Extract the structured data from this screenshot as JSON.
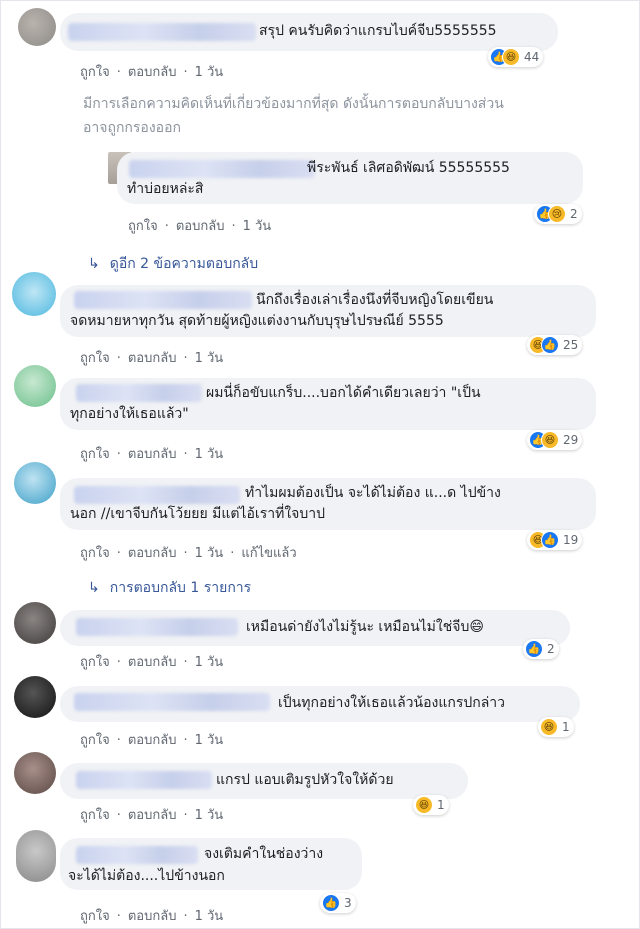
{
  "actions": {
    "like": "ถูกใจ",
    "reply": "ตอบกลับ",
    "time": "1 วัน",
    "edited": "แก้ไขแล้ว",
    "sep": "·"
  },
  "comments": [
    {
      "text": [
        "สรุป คนรับคิดว่าแกรบไบค์จีบ5555555"
      ],
      "reaction_count": "44",
      "reactions": [
        "like",
        "haha"
      ]
    },
    {
      "text": [
        "พีระพันธ์ เลิศอดิพัฒน์ 55555555",
        "ทำบ่อยหล่ะสิ"
      ],
      "reaction_count": "2",
      "reactions": [
        "like",
        "sad"
      ]
    },
    {
      "text": [
        "นึกถึงเรื่องเล่าเรื่องนึงที่จีบหญิงโดยเขียน",
        "จดหมายหาทุกวัน สุดท้ายผู้หญิงแต่งงานกับบุรุษไปรษณีย์ 5555"
      ],
      "reaction_count": "25",
      "reactions": [
        "haha",
        "like"
      ]
    },
    {
      "text": [
        "ผมนี่ก็อขับแกร็บ....บอกได้คำเดียวเลยว่า \"เป็น",
        "ทุกอย่างให้เธอแล้ว\""
      ],
      "reaction_count": "29",
      "reactions": [
        "like",
        "haha"
      ]
    },
    {
      "text": [
        "ทำไมผมต้องเป็น จะได้ไม่ต้อง แ...ด ไปข้าง",
        "นอก //เขาจีบกันโว้ยยย มีแต่ไอ้เราที่ใจบาป"
      ],
      "reaction_count": "19",
      "reactions": [
        "haha",
        "like"
      ]
    },
    {
      "text": [
        "เหมือนด่ายังไงไม่รู้นะ เหมือนไม่ใช่จีบ😄"
      ],
      "reaction_count": "2",
      "reactions": [
        "like"
      ]
    },
    {
      "text": [
        "เป็นทุกอย่างให้เธอแล้วน้องแกรปกล่าว"
      ],
      "reaction_count": "1",
      "reactions": [
        "haha"
      ]
    },
    {
      "text": [
        "แกรป แอบเติมรูปหัวใจให้ด้วย"
      ],
      "reaction_count": "1",
      "reactions": [
        "haha"
      ]
    },
    {
      "text": [
        "จงเติมคำในช่องว่าง",
        "จะได้ไม่ต้อง....ไปข้างนอก"
      ],
      "reaction_count": "3",
      "reactions": [
        "like"
      ]
    }
  ],
  "filter_notice": [
    "มีการเลือกความคิดเห็นที่เกี่ยวข้องมากที่สุด ดังนั้นการตอบกลับบางส่วน",
    "อาจถูกกรองออก"
  ],
  "view_more_replies": "ดูอีก 2 ข้อความตอบกลับ",
  "replies_count_link": "การตอบกลับ 1 รายการ",
  "colors": {
    "link": "#385898",
    "bubble": "#f0f2f5",
    "meta": "#606770",
    "like_blue": "#1877f2",
    "haha_yellow": "#f7b928"
  }
}
